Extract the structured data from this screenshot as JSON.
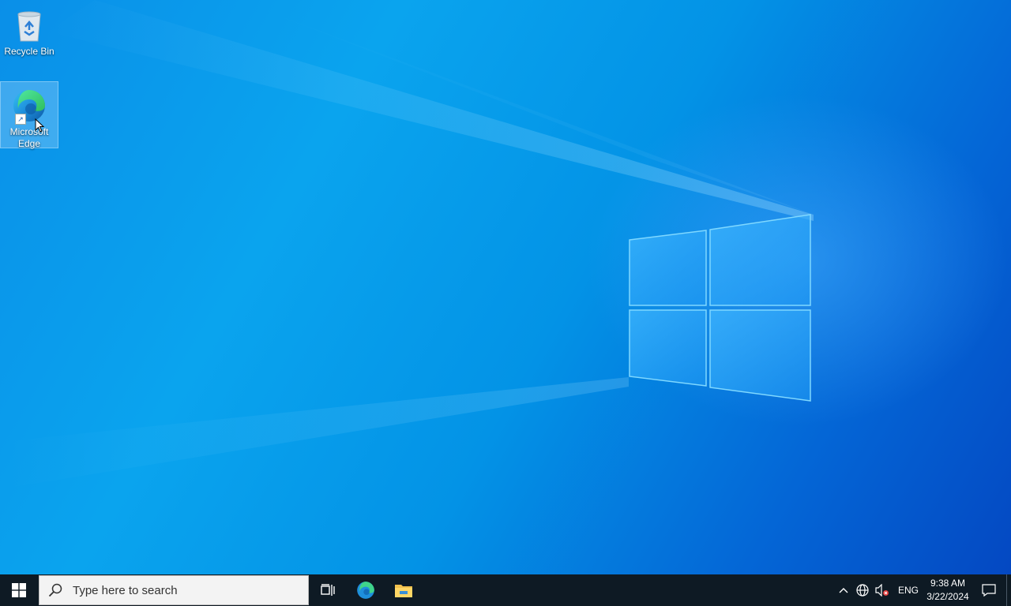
{
  "desktop": {
    "icons": [
      {
        "label": "Recycle Bin"
      },
      {
        "label_line1": "Microsoft",
        "label_line2": "Edge"
      }
    ]
  },
  "taskbar": {
    "start_icon": "windows-logo-icon",
    "search": {
      "placeholder": "Type here to search"
    },
    "pinned": [
      {
        "icon": "task-view-icon"
      },
      {
        "icon": "edge-icon"
      },
      {
        "icon": "file-explorer-icon"
      }
    ],
    "tray": {
      "language": "ENG",
      "time": "9:38 AM",
      "date": "3/22/2024"
    }
  },
  "colors": {
    "taskbar_bg": "#0e1a24",
    "desktop_accent": "#0aa4ee"
  }
}
